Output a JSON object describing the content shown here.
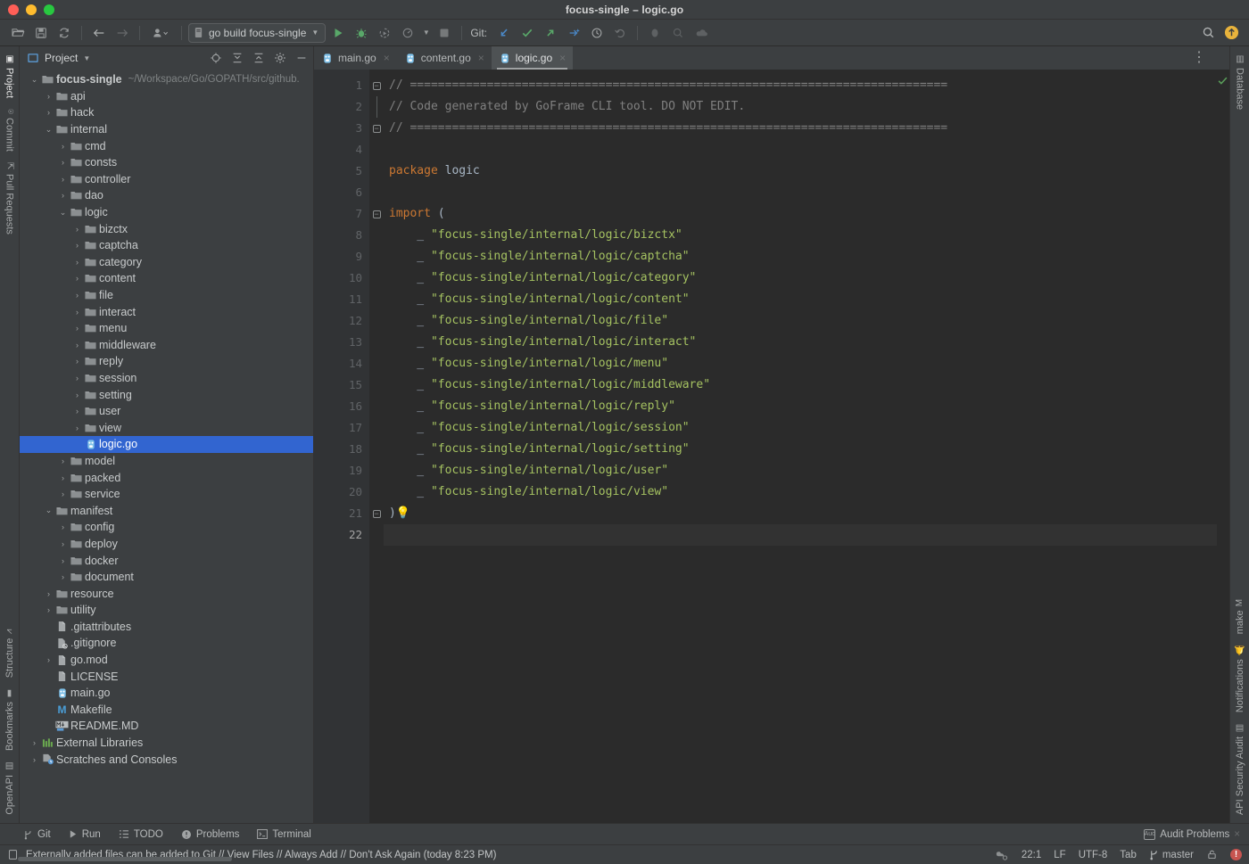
{
  "window": {
    "title": "focus-single – logic.go",
    "traffic_lights": [
      "close",
      "minimize",
      "zoom"
    ]
  },
  "toolbar": {
    "open_label": "open-folder",
    "save_label": "save",
    "sync_label": "sync",
    "back_label": "back",
    "forward_label": "forward",
    "profile_label": "profile",
    "run_config": "go build focus-single",
    "run_label": "Run",
    "debug_label": "Debug",
    "coverage_label": "Run with Coverage",
    "profiler_label": "Profiler",
    "stop_label": "Stop",
    "git_label": "Git:",
    "git_update_label": "Update Project",
    "git_commit_label": "Commit",
    "git_push_label": "Push",
    "git_ai_label": "AI Commit",
    "history_label": "History",
    "rollback_label": "Rollback",
    "search_label": "Search Everywhere",
    "account_label": "Account"
  },
  "left_stripe": {
    "top": [
      {
        "label": "Project",
        "icon": "project-icon",
        "active": true
      },
      {
        "label": "Commit",
        "icon": "commit-icon",
        "active": false
      },
      {
        "label": "Pull Requests",
        "icon": "pull-requests-icon",
        "active": false
      }
    ],
    "bottom": [
      {
        "label": "Structure",
        "icon": "structure-icon",
        "active": false
      },
      {
        "label": "Bookmarks",
        "icon": "bookmarks-icon",
        "active": false
      },
      {
        "label": "OpenAPI",
        "icon": "openapi-icon",
        "active": false
      }
    ]
  },
  "right_stripe": {
    "top": [
      {
        "label": "Database",
        "icon": "database-icon",
        "active": false
      }
    ],
    "bottom": [
      {
        "label": "make",
        "icon": "make-icon",
        "active": false
      },
      {
        "label": "Notifications",
        "icon": "notifications-icon",
        "active": false
      },
      {
        "label": "API Security Audit",
        "icon": "api-security-audit-icon",
        "active": false
      }
    ]
  },
  "project_panel": {
    "title": "Project",
    "icons": [
      {
        "name": "select-opened-file-icon",
        "glyph": "locate"
      },
      {
        "name": "expand-all-icon",
        "glyph": "expand"
      },
      {
        "name": "collapse-all-icon",
        "glyph": "collapse"
      },
      {
        "name": "settings-icon",
        "glyph": "gear"
      },
      {
        "name": "hide-icon",
        "glyph": "minus"
      }
    ],
    "tree": [
      {
        "label": "focus-single",
        "path": "~/Workspace/Go/GOPATH/src/github.",
        "depth": 0,
        "arrow": "down",
        "icon": "folder",
        "bold": true,
        "selected": false
      },
      {
        "label": "api",
        "depth": 1,
        "arrow": "right",
        "icon": "folder",
        "selected": false
      },
      {
        "label": "hack",
        "depth": 1,
        "arrow": "right",
        "icon": "folder",
        "selected": false
      },
      {
        "label": "internal",
        "depth": 1,
        "arrow": "down",
        "icon": "folder",
        "selected": false
      },
      {
        "label": "cmd",
        "depth": 2,
        "arrow": "right",
        "icon": "folder",
        "selected": false
      },
      {
        "label": "consts",
        "depth": 2,
        "arrow": "right",
        "icon": "folder",
        "selected": false
      },
      {
        "label": "controller",
        "depth": 2,
        "arrow": "right",
        "icon": "folder",
        "selected": false
      },
      {
        "label": "dao",
        "depth": 2,
        "arrow": "right",
        "icon": "folder",
        "selected": false
      },
      {
        "label": "logic",
        "depth": 2,
        "arrow": "down",
        "icon": "folder",
        "selected": false
      },
      {
        "label": "bizctx",
        "depth": 3,
        "arrow": "right",
        "icon": "folder",
        "selected": false
      },
      {
        "label": "captcha",
        "depth": 3,
        "arrow": "right",
        "icon": "folder",
        "selected": false
      },
      {
        "label": "category",
        "depth": 3,
        "arrow": "right",
        "icon": "folder",
        "selected": false
      },
      {
        "label": "content",
        "depth": 3,
        "arrow": "right",
        "icon": "folder",
        "selected": false
      },
      {
        "label": "file",
        "depth": 3,
        "arrow": "right",
        "icon": "folder",
        "selected": false
      },
      {
        "label": "interact",
        "depth": 3,
        "arrow": "right",
        "icon": "folder",
        "selected": false
      },
      {
        "label": "menu",
        "depth": 3,
        "arrow": "right",
        "icon": "folder",
        "selected": false
      },
      {
        "label": "middleware",
        "depth": 3,
        "arrow": "right",
        "icon": "folder",
        "selected": false
      },
      {
        "label": "reply",
        "depth": 3,
        "arrow": "right",
        "icon": "folder",
        "selected": false
      },
      {
        "label": "session",
        "depth": 3,
        "arrow": "right",
        "icon": "folder",
        "selected": false
      },
      {
        "label": "setting",
        "depth": 3,
        "arrow": "right",
        "icon": "folder",
        "selected": false
      },
      {
        "label": "user",
        "depth": 3,
        "arrow": "right",
        "icon": "folder",
        "selected": false
      },
      {
        "label": "view",
        "depth": 3,
        "arrow": "right",
        "icon": "folder",
        "selected": false
      },
      {
        "label": "logic.go",
        "depth": 3,
        "arrow": "none",
        "icon": "go",
        "selected": true
      },
      {
        "label": "model",
        "depth": 2,
        "arrow": "right",
        "icon": "folder",
        "selected": false
      },
      {
        "label": "packed",
        "depth": 2,
        "arrow": "right",
        "icon": "folder",
        "selected": false
      },
      {
        "label": "service",
        "depth": 2,
        "arrow": "right",
        "icon": "folder",
        "selected": false
      },
      {
        "label": "manifest",
        "depth": 1,
        "arrow": "down",
        "icon": "folder",
        "selected": false
      },
      {
        "label": "config",
        "depth": 2,
        "arrow": "right",
        "icon": "folder",
        "selected": false
      },
      {
        "label": "deploy",
        "depth": 2,
        "arrow": "right",
        "icon": "folder",
        "selected": false
      },
      {
        "label": "docker",
        "depth": 2,
        "arrow": "right",
        "icon": "folder",
        "selected": false
      },
      {
        "label": "document",
        "depth": 2,
        "arrow": "right",
        "icon": "folder",
        "selected": false
      },
      {
        "label": "resource",
        "depth": 1,
        "arrow": "right",
        "icon": "folder",
        "selected": false
      },
      {
        "label": "utility",
        "depth": 1,
        "arrow": "right",
        "icon": "folder",
        "selected": false
      },
      {
        "label": ".gitattributes",
        "depth": 1,
        "arrow": "none",
        "icon": "file",
        "selected": false
      },
      {
        "label": ".gitignore",
        "depth": 1,
        "arrow": "none",
        "icon": "gitignore",
        "selected": false
      },
      {
        "label": "go.mod",
        "depth": 1,
        "arrow": "right",
        "icon": "file",
        "selected": false
      },
      {
        "label": "LICENSE",
        "depth": 1,
        "arrow": "none",
        "icon": "file",
        "selected": false
      },
      {
        "label": "main.go",
        "depth": 1,
        "arrow": "none",
        "icon": "go",
        "selected": false
      },
      {
        "label": "Makefile",
        "depth": 1,
        "arrow": "none",
        "icon": "makefile",
        "selected": false
      },
      {
        "label": "README.MD",
        "depth": 1,
        "arrow": "none",
        "icon": "markdown",
        "selected": false
      },
      {
        "label": "External Libraries",
        "depth": 0,
        "arrow": "right",
        "icon": "libraries",
        "selected": false
      },
      {
        "label": "Scratches and Consoles",
        "depth": 0,
        "arrow": "right",
        "icon": "scratches",
        "selected": false
      }
    ]
  },
  "editor": {
    "tabs": [
      {
        "label": "main.go",
        "icon": "go-file-icon",
        "active": false
      },
      {
        "label": "content.go",
        "icon": "go-file-icon",
        "active": false
      },
      {
        "label": "logic.go",
        "icon": "go-file-icon",
        "active": true
      }
    ],
    "options_label": "Options",
    "inspection_status": "ok",
    "current_line": 22,
    "lines": [
      {
        "n": 1,
        "fold": "start",
        "tokens": [
          {
            "t": "// =============================================================================",
            "c": "comment"
          }
        ]
      },
      {
        "n": 2,
        "fold": "mid",
        "tokens": [
          {
            "t": "// Code generated by GoFrame CLI tool. DO NOT EDIT.",
            "c": "comment"
          }
        ]
      },
      {
        "n": 3,
        "fold": "end",
        "tokens": [
          {
            "t": "// =============================================================================",
            "c": "comment"
          }
        ]
      },
      {
        "n": 4,
        "tokens": []
      },
      {
        "n": 5,
        "tokens": [
          {
            "t": "package ",
            "c": "kw"
          },
          {
            "t": "logic",
            "c": "ident"
          }
        ]
      },
      {
        "n": 6,
        "tokens": []
      },
      {
        "n": 7,
        "fold": "start",
        "tokens": [
          {
            "t": "import",
            "c": "kw"
          },
          {
            "t": " (",
            "c": "plain"
          }
        ]
      },
      {
        "n": 8,
        "tokens": [
          {
            "t": "    _ ",
            "c": "plain"
          },
          {
            "t": "\"focus-single/internal/logic/bizctx\"",
            "c": "str"
          }
        ]
      },
      {
        "n": 9,
        "tokens": [
          {
            "t": "    _ ",
            "c": "plain"
          },
          {
            "t": "\"focus-single/internal/logic/captcha\"",
            "c": "str"
          }
        ]
      },
      {
        "n": 10,
        "tokens": [
          {
            "t": "    _ ",
            "c": "plain"
          },
          {
            "t": "\"focus-single/internal/logic/category\"",
            "c": "str"
          }
        ]
      },
      {
        "n": 11,
        "tokens": [
          {
            "t": "    _ ",
            "c": "plain"
          },
          {
            "t": "\"focus-single/internal/logic/content\"",
            "c": "str"
          }
        ]
      },
      {
        "n": 12,
        "tokens": [
          {
            "t": "    _ ",
            "c": "plain"
          },
          {
            "t": "\"focus-single/internal/logic/file\"",
            "c": "str"
          }
        ]
      },
      {
        "n": 13,
        "tokens": [
          {
            "t": "    _ ",
            "c": "plain"
          },
          {
            "t": "\"focus-single/internal/logic/interact\"",
            "c": "str"
          }
        ]
      },
      {
        "n": 14,
        "tokens": [
          {
            "t": "    _ ",
            "c": "plain"
          },
          {
            "t": "\"focus-single/internal/logic/menu\"",
            "c": "str"
          }
        ]
      },
      {
        "n": 15,
        "tokens": [
          {
            "t": "    _ ",
            "c": "plain"
          },
          {
            "t": "\"focus-single/internal/logic/middleware\"",
            "c": "str"
          }
        ]
      },
      {
        "n": 16,
        "tokens": [
          {
            "t": "    _ ",
            "c": "plain"
          },
          {
            "t": "\"focus-single/internal/logic/reply\"",
            "c": "str"
          }
        ]
      },
      {
        "n": 17,
        "tokens": [
          {
            "t": "    _ ",
            "c": "plain"
          },
          {
            "t": "\"focus-single/internal/logic/session\"",
            "c": "str"
          }
        ]
      },
      {
        "n": 18,
        "tokens": [
          {
            "t": "    _ ",
            "c": "plain"
          },
          {
            "t": "\"focus-single/internal/logic/setting\"",
            "c": "str"
          }
        ]
      },
      {
        "n": 19,
        "tokens": [
          {
            "t": "    _ ",
            "c": "plain"
          },
          {
            "t": "\"focus-single/internal/logic/user\"",
            "c": "str"
          }
        ]
      },
      {
        "n": 20,
        "tokens": [
          {
            "t": "    _ ",
            "c": "plain"
          },
          {
            "t": "\"focus-single/internal/logic/view\"",
            "c": "str"
          }
        ]
      },
      {
        "n": 21,
        "fold": "end",
        "bulb": true,
        "tokens": [
          {
            "t": ")",
            "c": "plain"
          }
        ]
      },
      {
        "n": 22,
        "current": true,
        "tokens": []
      }
    ]
  },
  "tool_windows": [
    {
      "label": "Git",
      "icon": "git-branch-icon"
    },
    {
      "label": "Run",
      "icon": "run-icon"
    },
    {
      "label": "TODO",
      "icon": "todo-icon"
    },
    {
      "label": "Problems",
      "icon": "problems-icon"
    },
    {
      "label": "Terminal",
      "icon": "terminal-icon"
    }
  ],
  "audit_badge": {
    "label": "Audit Problems",
    "icon": "audit-icon",
    "close": "×"
  },
  "status_bar": {
    "message": "Externally added files can be added to Git // View Files // Always Add // Don't Ask Again (today 8:23 PM)",
    "message_icon": "notification-icon",
    "inspection_icon": "inspection-profile-icon",
    "caret_position": "22:1",
    "line_separator": "LF",
    "encoding": "UTF-8",
    "indent": "Tab",
    "branch": "master",
    "branch_icon": "git-branch-icon",
    "lock_icon": "read-only-lock-icon",
    "error_badge": "!"
  },
  "colors": {
    "accent_selection": "#3265d0",
    "panel_bg": "#3c3f41",
    "editor_bg": "#2b2b2b",
    "gutter_bg": "#313335",
    "comment": "#808080",
    "keyword": "#cc7832",
    "string": "#a5c261",
    "identifier": "#a9b7c6",
    "ok_green": "#5a9e5a",
    "error_red": "#c75450",
    "bulb_yellow": "#f0c14b"
  }
}
